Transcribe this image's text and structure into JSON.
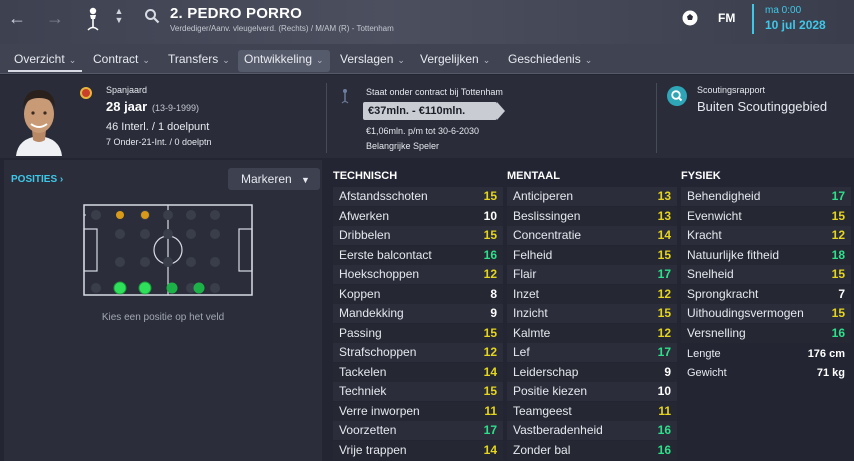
{
  "header": {
    "player_name": "2. PEDRO PORRO",
    "player_sub": "Verdediger/Aanv. vleugelverd. (Rechts) / M/AM (R) - Tottenham",
    "brand": "FM",
    "time": "ma 0:00",
    "date": "10 jul 2028",
    "accent": "#3fc7e8"
  },
  "tabs": [
    {
      "label": "Overzicht"
    },
    {
      "label": "Contract"
    },
    {
      "label": "Transfers"
    },
    {
      "label": "Ontwikkeling"
    },
    {
      "label": "Verslagen"
    },
    {
      "label": "Vergelijken"
    },
    {
      "label": "Geschiedenis"
    }
  ],
  "info": {
    "nationality": "Spanjaard",
    "age": "28 jaar",
    "dob": "(13-9-1999)",
    "caps": "46 Interl. / 1 doelpunt",
    "u21": "7 Onder-21-Int. / 0 doelptn",
    "contract_status": "Staat onder contract bij Tottenham",
    "value_range": "€37mln. - €110mln.",
    "wage": "€1,06mln. p/m tot 30-6-2030",
    "role_status": "Belangrijke Speler",
    "scout_title": "Scoutingsrapport",
    "scout_value": "Buiten Scoutinggebied"
  },
  "left": {
    "positions_label": "POSITIES",
    "mark_button": "Markeren",
    "pitch_hint": "Kies een positie op het veld"
  },
  "technical": {
    "title": "TECHNISCH",
    "rows": [
      {
        "label": "Afstandsschoten",
        "value": "15"
      },
      {
        "label": "Afwerken",
        "value": "10"
      },
      {
        "label": "Dribbelen",
        "value": "15"
      },
      {
        "label": "Eerste balcontact",
        "value": "16"
      },
      {
        "label": "Hoekschoppen",
        "value": "12"
      },
      {
        "label": "Koppen",
        "value": "8"
      },
      {
        "label": "Mandekking",
        "value": "9"
      },
      {
        "label": "Passing",
        "value": "15"
      },
      {
        "label": "Strafschoppen",
        "value": "12"
      },
      {
        "label": "Tackelen",
        "value": "14"
      },
      {
        "label": "Techniek",
        "value": "15"
      },
      {
        "label": "Verre inworpen",
        "value": "11"
      },
      {
        "label": "Voorzetten",
        "value": "17"
      },
      {
        "label": "Vrije trappen",
        "value": "14"
      }
    ]
  },
  "mental": {
    "title": "MENTAAL",
    "rows": [
      {
        "label": "Anticiperen",
        "value": "13"
      },
      {
        "label": "Beslissingen",
        "value": "13"
      },
      {
        "label": "Concentratie",
        "value": "14"
      },
      {
        "label": "Felheid",
        "value": "15"
      },
      {
        "label": "Flair",
        "value": "17"
      },
      {
        "label": "Inzet",
        "value": "12"
      },
      {
        "label": "Inzicht",
        "value": "15"
      },
      {
        "label": "Kalmte",
        "value": "12"
      },
      {
        "label": "Lef",
        "value": "17"
      },
      {
        "label": "Leiderschap",
        "value": "9"
      },
      {
        "label": "Positie kiezen",
        "value": "10"
      },
      {
        "label": "Teamgeest",
        "value": "11"
      },
      {
        "label": "Vastberadenheid",
        "value": "16"
      },
      {
        "label": "Zonder bal",
        "value": "16"
      }
    ]
  },
  "physical": {
    "title": "FYSIEK",
    "rows": [
      {
        "label": "Behendigheid",
        "value": "17"
      },
      {
        "label": "Evenwicht",
        "value": "15"
      },
      {
        "label": "Kracht",
        "value": "12"
      },
      {
        "label": "Natuurlijke fitheid",
        "value": "18"
      },
      {
        "label": "Snelheid",
        "value": "15"
      },
      {
        "label": "Sprongkracht",
        "value": "7"
      },
      {
        "label": "Uithoudingsvermogen",
        "value": "15"
      },
      {
        "label": "Versnelling",
        "value": "16"
      }
    ],
    "height_label": "Lengte",
    "height_value": "176 cm",
    "weight_label": "Gewicht",
    "weight_value": "71 kg"
  }
}
